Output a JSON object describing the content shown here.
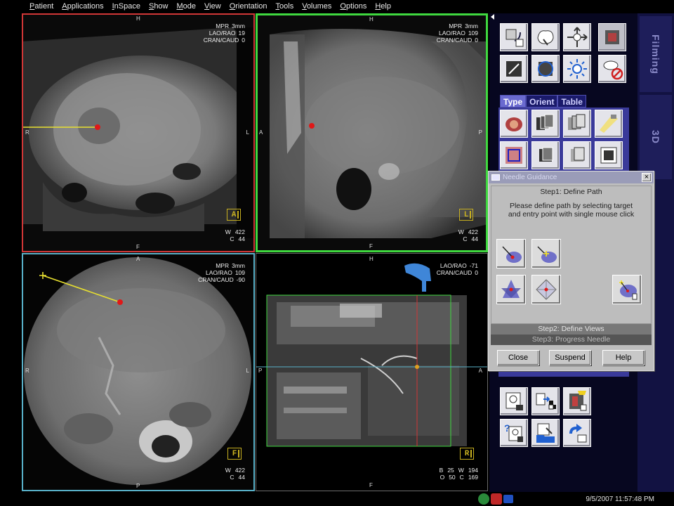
{
  "menu": [
    "Patient",
    "Applications",
    "InSpace",
    "Show",
    "Mode",
    "View",
    "Orientation",
    "Tools",
    "Volumes",
    "Options",
    "Help"
  ],
  "viewports": [
    {
      "id": "axial",
      "top_label": "H",
      "bottom_label": "F",
      "left_label": "R",
      "right_label": "L",
      "info": [
        [
          "MPR",
          "3mm"
        ],
        [
          "LAO/RAO",
          "19"
        ],
        [
          "CRAN/CAUD",
          "0"
        ]
      ],
      "cube": "A",
      "window": [
        [
          "W",
          "422"
        ],
        [
          "C",
          "44"
        ]
      ]
    },
    {
      "id": "sagittal",
      "top_label": "H",
      "bottom_label": "F",
      "left_label": "A",
      "right_label": "P",
      "info": [
        [
          "MPR",
          "3mm"
        ],
        [
          "LAO/RAO",
          "109"
        ],
        [
          "CRAN/CAUD",
          "0"
        ]
      ],
      "cube": "L",
      "window": [
        [
          "W",
          "422"
        ],
        [
          "C",
          "44"
        ]
      ]
    },
    {
      "id": "oblique",
      "top_label": "A",
      "bottom_label": "P",
      "left_label": "R",
      "right_label": "L",
      "info": [
        [
          "MPR",
          "3mm"
        ],
        [
          "LAO/RAO",
          "109"
        ],
        [
          "CRAN/CAUD",
          "-90"
        ]
      ],
      "cube": "F",
      "window": [
        [
          "W",
          "422"
        ],
        [
          "C",
          "44"
        ]
      ]
    },
    {
      "id": "volume-3d",
      "top_label": "H",
      "bottom_label": "F",
      "left_label": "P",
      "right_label": "A",
      "info": [
        [
          "LAO/RAO",
          "-71"
        ],
        [
          "CRAN/CAUD",
          "0"
        ]
      ],
      "cube": "R",
      "window": [
        [
          "B",
          "25",
          "W",
          "194"
        ],
        [
          "O",
          "50",
          "C",
          "169"
        ]
      ]
    }
  ],
  "type_tabs": [
    "Type",
    "Orient",
    "Table"
  ],
  "side_tabs": [
    "Filming",
    "3D"
  ],
  "dialog": {
    "title": "Needle Guidance",
    "close_glyph": "×",
    "step1_header": "Step1: Define Path",
    "step1_message_line1": "Please define path by selecting target",
    "step1_message_line2": "and entry point with single mouse click",
    "step2": "Step2: Define Views",
    "step3": "Step3: Progress Needle",
    "buttons": {
      "close": "Close",
      "suspend": "Suspend",
      "help": "Help"
    }
  },
  "toolbar_icons": [
    "rotate-icon",
    "zoom-3d-icon",
    "pan-icon",
    "film-icon",
    "slab-icon",
    "orbit-icon",
    "brightness-icon",
    "annotation-off-icon"
  ],
  "clock": "9/5/2007 11:57:48 PM",
  "colors": {
    "axial_frame": "#d03636",
    "sagittal_frame": "#3fd83f",
    "oblique_frame": "#58b0c8",
    "needle": "#e8e030",
    "target": "#e01818",
    "panel": "#070720",
    "tab_active": "#6a6ad0"
  }
}
